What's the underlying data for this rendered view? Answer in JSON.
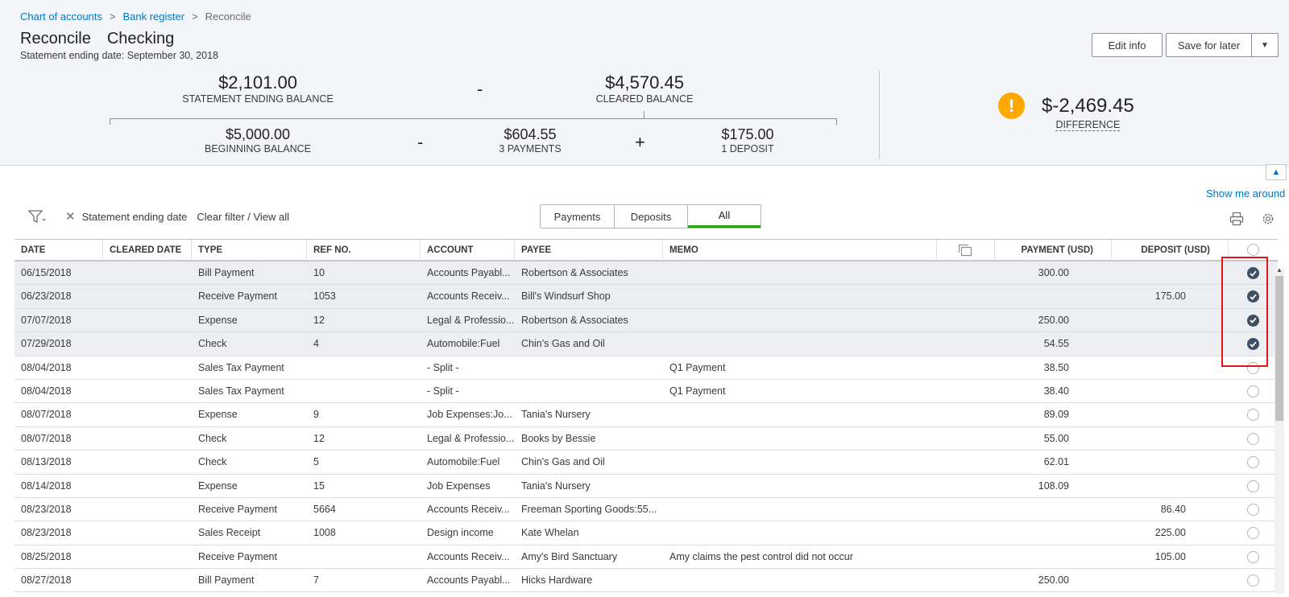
{
  "breadcrumb": {
    "item1": "Chart of accounts",
    "item2": "Bank register",
    "current": "Reconcile",
    "separator": ">"
  },
  "header": {
    "title": "Reconcile",
    "account": "Checking",
    "statement_date": "Statement ending date: September 30, 2018"
  },
  "buttons": {
    "edit_info": "Edit info",
    "save_for_later": "Save for later"
  },
  "summary": {
    "statement_ending_balance": {
      "value": "$2,101.00",
      "label": "STATEMENT ENDING BALANCE"
    },
    "cleared_balance": {
      "value": "$4,570.45",
      "label": "CLEARED BALANCE"
    },
    "beginning_balance": {
      "value": "$5,000.00",
      "label": "BEGINNING BALANCE"
    },
    "payments": {
      "value": "$604.55",
      "label": "3 PAYMENTS"
    },
    "deposits": {
      "value": "$175.00",
      "label": "1 DEPOSIT"
    },
    "op_minus": "-",
    "op_plus": "+",
    "difference": {
      "value": "$-2,469.45",
      "label": "DIFFERENCE"
    }
  },
  "colors": {
    "accent": "#2ca01c",
    "link": "#0077c5",
    "warning": "#ffa800",
    "highlight": "#e01616"
  },
  "show_me_around": "Show me around",
  "filter": {
    "chip_label": "Statement ending date",
    "clear_label": "Clear filter / View all"
  },
  "tabs": [
    "Payments",
    "Deposits",
    "All"
  ],
  "selected_tab": "All",
  "icons": {
    "filter": "filter-funnel-icon",
    "print": "printer-icon",
    "settings": "gear-icon",
    "memo_toggle": "copy-icon",
    "collapse": "chevron-up-icon",
    "warning": "exclamation-icon"
  },
  "table": {
    "columns": [
      "DATE",
      "CLEARED DATE",
      "TYPE",
      "REF NO.",
      "ACCOUNT",
      "PAYEE",
      "MEMO",
      "",
      "PAYMENT (USD)",
      "DEPOSIT (USD)"
    ],
    "rows": [
      {
        "date": "06/15/2018",
        "cleared_date": "",
        "type": "Bill Payment",
        "ref": "10",
        "account": "Accounts Payabl...",
        "payee": "Robertson & Associates",
        "memo": "",
        "payment": "300.00",
        "deposit": "",
        "checked": true
      },
      {
        "date": "06/23/2018",
        "cleared_date": "",
        "type": "Receive Payment",
        "ref": "1053",
        "account": "Accounts Receiv...",
        "payee": "Bill's Windsurf Shop",
        "memo": "",
        "payment": "",
        "deposit": "175.00",
        "checked": true
      },
      {
        "date": "07/07/2018",
        "cleared_date": "",
        "type": "Expense",
        "ref": "12",
        "account": "Legal & Professio...",
        "payee": "Robertson & Associates",
        "memo": "",
        "payment": "250.00",
        "deposit": "",
        "checked": true
      },
      {
        "date": "07/29/2018",
        "cleared_date": "",
        "type": "Check",
        "ref": "4",
        "account": "Automobile:Fuel",
        "payee": "Chin's Gas and Oil",
        "memo": "",
        "payment": "54.55",
        "deposit": "",
        "checked": true
      },
      {
        "date": "08/04/2018",
        "cleared_date": "",
        "type": "Sales Tax Payment",
        "ref": "",
        "account": "- Split -",
        "payee": "",
        "memo": "Q1 Payment",
        "payment": "38.50",
        "deposit": "",
        "checked": false
      },
      {
        "date": "08/04/2018",
        "cleared_date": "",
        "type": "Sales Tax Payment",
        "ref": "",
        "account": "- Split -",
        "payee": "",
        "memo": "Q1 Payment",
        "payment": "38.40",
        "deposit": "",
        "checked": false
      },
      {
        "date": "08/07/2018",
        "cleared_date": "",
        "type": "Expense",
        "ref": "9",
        "account": "Job Expenses:Jo...",
        "payee": "Tania's Nursery",
        "memo": "",
        "payment": "89.09",
        "deposit": "",
        "checked": false
      },
      {
        "date": "08/07/2018",
        "cleared_date": "",
        "type": "Check",
        "ref": "12",
        "account": "Legal & Professio...",
        "payee": "Books by Bessie",
        "memo": "",
        "payment": "55.00",
        "deposit": "",
        "checked": false
      },
      {
        "date": "08/13/2018",
        "cleared_date": "",
        "type": "Check",
        "ref": "5",
        "account": "Automobile:Fuel",
        "payee": "Chin's Gas and Oil",
        "memo": "",
        "payment": "62.01",
        "deposit": "",
        "checked": false
      },
      {
        "date": "08/14/2018",
        "cleared_date": "",
        "type": "Expense",
        "ref": "15",
        "account": "Job Expenses",
        "payee": "Tania's Nursery",
        "memo": "",
        "payment": "108.09",
        "deposit": "",
        "checked": false
      },
      {
        "date": "08/23/2018",
        "cleared_date": "",
        "type": "Receive Payment",
        "ref": "5664",
        "account": "Accounts Receiv...",
        "payee": "Freeman Sporting Goods:55...",
        "memo": "",
        "payment": "",
        "deposit": "86.40",
        "checked": false
      },
      {
        "date": "08/23/2018",
        "cleared_date": "",
        "type": "Sales Receipt",
        "ref": "1008",
        "account": "Design income",
        "payee": "Kate Whelan",
        "memo": "",
        "payment": "",
        "deposit": "225.00",
        "checked": false
      },
      {
        "date": "08/25/2018",
        "cleared_date": "",
        "type": "Receive Payment",
        "ref": "",
        "account": "Accounts Receiv...",
        "payee": "Amy's Bird Sanctuary",
        "memo": "Amy claims the pest control did not occur",
        "payment": "",
        "deposit": "105.00",
        "checked": false
      },
      {
        "date": "08/27/2018",
        "cleared_date": "",
        "type": "Bill Payment",
        "ref": "7",
        "account": "Accounts Payabl...",
        "payee": "Hicks Hardware",
        "memo": "",
        "payment": "250.00",
        "deposit": "",
        "checked": false
      }
    ]
  }
}
